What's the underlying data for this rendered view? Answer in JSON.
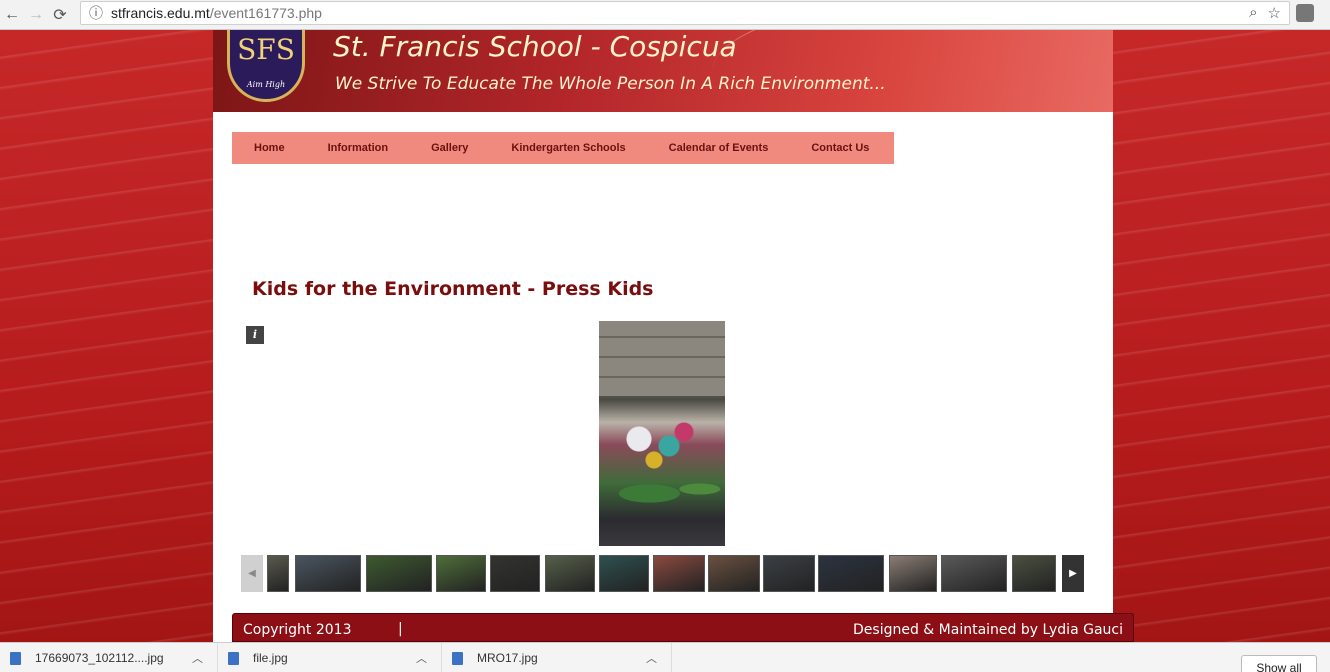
{
  "browser": {
    "url_host": "stfrancis.edu.mt",
    "url_path": "/event161773.php"
  },
  "site": {
    "title": "St. Francis School - Cospicua",
    "motto": "We Strive To Educate The Whole Person In A Rich Environment...",
    "crest_letters": "SFS",
    "crest_motto": "Aim High"
  },
  "nav": {
    "items": [
      "Home",
      "Information",
      "Gallery",
      "Kindergarten Schools",
      "Calendar of Events",
      "Contact Us"
    ]
  },
  "event": {
    "title": "Kids for the Environment - Press Kids",
    "info_label": "i"
  },
  "thumbnails": {
    "colors": [
      "#5a5a4e",
      "#4a5560",
      "#3d5a30",
      "#4f6e3a",
      "#333330",
      "#55604a",
      "#2e5050",
      "#8a4a40",
      "#6a5040",
      "#3b4045",
      "#2c3340",
      "#8b7d75",
      "#5a5a5a",
      "#4a5040"
    ]
  },
  "footer": {
    "copyright": "Copyright 2013",
    "separator": "|",
    "credit": "Designed & Maintained by Lydia Gauci"
  },
  "downloads": {
    "items": [
      "17669073_102112....jpg",
      "file.jpg",
      "MRO17.jpg"
    ],
    "show_all": "Show all"
  }
}
